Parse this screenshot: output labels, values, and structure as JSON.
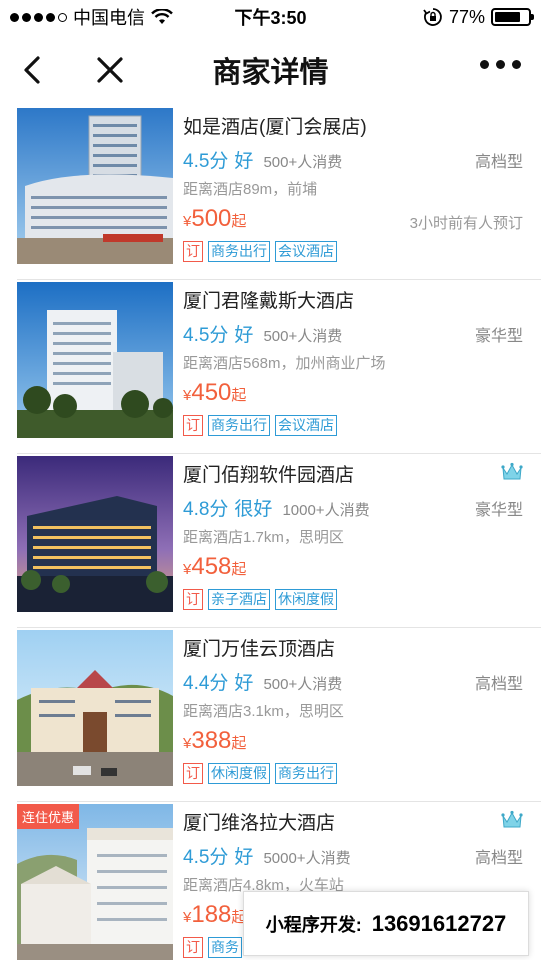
{
  "status_bar": {
    "carrier": "中国电信",
    "time": "下午3:50",
    "battery": "77%",
    "battery_level": 0.77
  },
  "nav": {
    "title": "商家详情"
  },
  "hotels": [
    {
      "name": "如是酒店(厦门会展店)",
      "score": "4.5分",
      "grade": "好",
      "consumption": "500+人消费",
      "level": "高档型",
      "distance": "距离酒店89m，前埔",
      "currency": "¥",
      "price": "500",
      "price_suffix": "起",
      "booked": "3小时前有人预订",
      "tags": [
        "订",
        "商务出行",
        "会议酒店"
      ]
    },
    {
      "name": "厦门君隆戴斯大酒店",
      "score": "4.5分",
      "grade": "好",
      "consumption": "500+人消费",
      "level": "豪华型",
      "distance": "距离酒店568m，加州商业广场",
      "currency": "¥",
      "price": "450",
      "price_suffix": "起",
      "tags": [
        "订",
        "商务出行",
        "会议酒店"
      ]
    },
    {
      "name": "厦门佰翔软件园酒店",
      "score": "4.8分",
      "grade": "很好",
      "consumption": "1000+人消费",
      "level": "豪华型",
      "distance": "距离酒店1.7km，思明区",
      "currency": "¥",
      "price": "458",
      "price_suffix": "起",
      "tags": [
        "订",
        "亲子酒店",
        "休闲度假"
      ]
    },
    {
      "name": "厦门万佳云顶酒店",
      "score": "4.4分",
      "grade": "好",
      "consumption": "500+人消费",
      "level": "高档型",
      "distance": "距离酒店3.1km，思明区",
      "currency": "¥",
      "price": "388",
      "price_suffix": "起",
      "tags": [
        "订",
        "休闲度假",
        "商务出行"
      ]
    },
    {
      "name": "厦门维洛拉大酒店",
      "badge": "连住优惠",
      "score": "4.5分",
      "grade": "好",
      "consumption": "5000+人消费",
      "level": "高档型",
      "distance": "距离酒店4.8km，火车站",
      "currency": "¥",
      "price": "188",
      "price_suffix": "起",
      "tags": [
        "订",
        "商务"
      ]
    }
  ],
  "dev_box": {
    "label": "小程序开发:",
    "phone": "13691612727"
  },
  "colors": {
    "accent_blue": "#2e9bd6",
    "price_orange": "#f2603c",
    "tag_red": "#f25a4a"
  }
}
